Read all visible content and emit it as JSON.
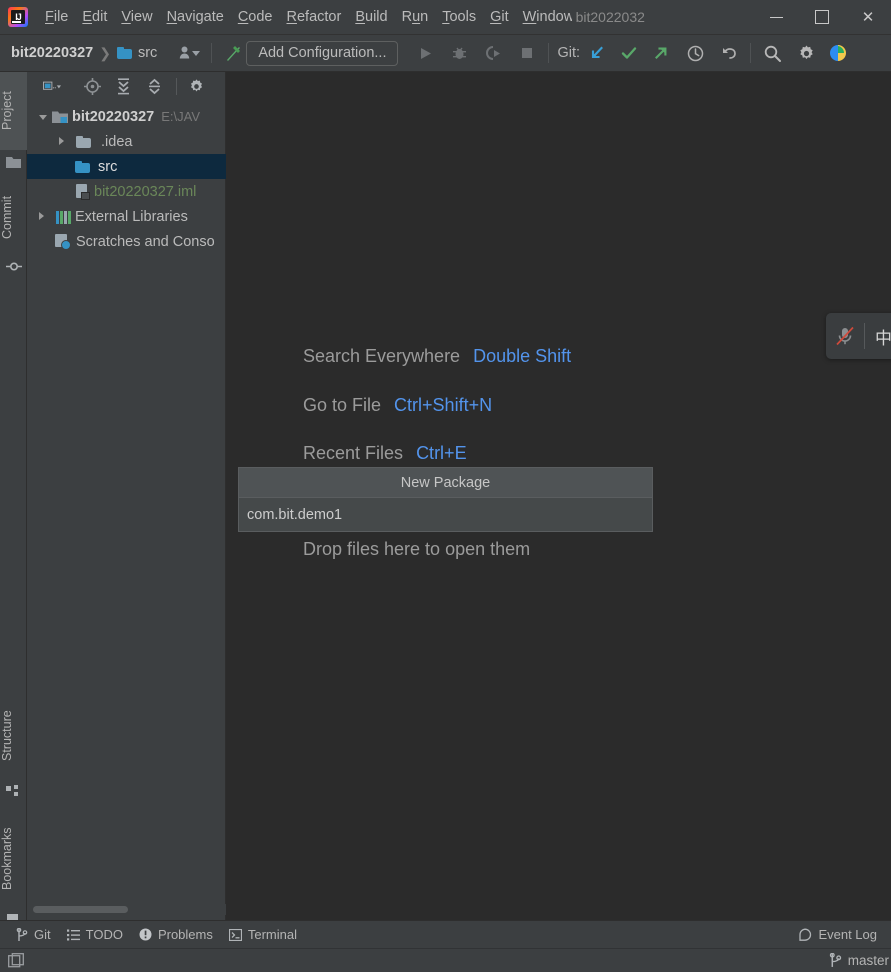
{
  "window": {
    "title": "bit2022032",
    "logo_text": "IJ",
    "minimize_label": "Minimize",
    "maximize_label": "Maximize",
    "close_label": "✕"
  },
  "menubar": {
    "items": [
      {
        "label": "File",
        "mnemonic": "F"
      },
      {
        "label": "Edit",
        "mnemonic": "E"
      },
      {
        "label": "View",
        "mnemonic": "V"
      },
      {
        "label": "Navigate",
        "mnemonic": "N"
      },
      {
        "label": "Code",
        "mnemonic": "C"
      },
      {
        "label": "Refactor",
        "mnemonic": "R"
      },
      {
        "label": "Build",
        "mnemonic": "B"
      },
      {
        "label": "Run",
        "mnemonic": "u"
      },
      {
        "label": "Tools",
        "mnemonic": "T"
      },
      {
        "label": "Git",
        "mnemonic": "G"
      },
      {
        "label": "Window",
        "mnemonic": "W"
      }
    ]
  },
  "navbar": {
    "breadcrumb_root": "bit20220327",
    "breadcrumb_separator": "❯",
    "breadcrumb_leaf": "src",
    "add_configuration_label": "Add Configuration...",
    "git_label": "Git:",
    "icons": {
      "user": "user-dropdown-icon",
      "build": "build-hammer-icon",
      "run": "run-icon",
      "debug": "debug-icon",
      "run_coverage": "run-with-coverage-icon",
      "stop": "stop-icon",
      "git_update": "git-update-project-icon",
      "git_commit": "git-commit-icon",
      "git_push": "git-push-icon",
      "git_history": "git-history-icon",
      "git_rollback": "git-rollback-icon",
      "search": "search-everywhere-icon",
      "settings": "settings-gear-icon",
      "plugin": "plugin-icon"
    }
  },
  "left_toolstrip": {
    "tabs": [
      {
        "label": "Project",
        "active": true,
        "icon": "project-folder-icon"
      },
      {
        "label": "Commit",
        "active": false,
        "icon": "commit-icon"
      },
      {
        "label": "Structure",
        "active": false,
        "icon": "structure-icon"
      },
      {
        "label": "Bookmarks",
        "active": false,
        "icon": "bookmark-icon"
      }
    ]
  },
  "project_panel": {
    "toolbar_icons": [
      "project-view-select-icon",
      "scroll-from-source-icon",
      "expand-all-icon",
      "collapse-all-icon",
      "settings-gear-icon"
    ],
    "tree": [
      {
        "label": "bit20220327",
        "detail": "E:\\JAV",
        "icon": "module-folder-icon",
        "expander": "down",
        "indent": 0,
        "selected": false,
        "bold": true,
        "color": "#cfcfcf"
      },
      {
        "label": ".idea",
        "detail": "",
        "icon": "folder-icon",
        "expander": "right",
        "indent": 1,
        "selected": false,
        "bold": false,
        "color": "#bbbbbb"
      },
      {
        "label": "src",
        "detail": "",
        "icon": "source-folder-icon",
        "expander": "none",
        "indent": 2,
        "selected": true,
        "bold": false,
        "color": "#dddddd"
      },
      {
        "label": "bit20220327.iml",
        "detail": "",
        "icon": "iml-file-icon",
        "expander": "none",
        "indent": 2,
        "selected": false,
        "bold": false,
        "color": "#6a8759"
      },
      {
        "label": "External Libraries",
        "detail": "",
        "icon": "library-icon",
        "expander": "right",
        "indent": 0,
        "selected": false,
        "bold": false,
        "color": "#bbbbbb"
      },
      {
        "label": "Scratches and Conso",
        "detail": "",
        "icon": "scratches-icon",
        "expander": "none",
        "indent": 1,
        "selected": false,
        "bold": false,
        "color": "#bbbbbb"
      }
    ]
  },
  "editor": {
    "hints": [
      {
        "text": "Search Everywhere",
        "shortcut": "Double Shift"
      },
      {
        "text": "Go to File",
        "shortcut": "Ctrl+Shift+N"
      },
      {
        "text": "Recent Files",
        "shortcut": "Ctrl+E"
      },
      {
        "text": "Drop files here to open them",
        "shortcut": ""
      }
    ]
  },
  "popup": {
    "title": "New Package",
    "value": "com.bit.demo1",
    "placeholder": ""
  },
  "ime_widget": {
    "mic_icon": "microphone-muted-icon",
    "language": "中"
  },
  "toolwindow_bar": {
    "left": [
      {
        "label": "Git",
        "icon": "git-branch-icon"
      },
      {
        "label": "TODO",
        "icon": "todo-list-icon"
      },
      {
        "label": "Problems",
        "icon": "problems-icon"
      },
      {
        "label": "Terminal",
        "icon": "terminal-icon"
      }
    ],
    "right": [
      {
        "label": "Event Log",
        "icon": "event-log-icon"
      }
    ]
  },
  "statusbar": {
    "left_icon": "toggle-tool-windows-icon",
    "branch": "master",
    "branch_icon": "git-branch-icon"
  },
  "colors": {
    "panel_bg": "#3c3f41",
    "editor_bg": "#2b2b2b",
    "selection": "#0d293e",
    "accent_blue": "#5394ec",
    "folder_blue": "#3592c4",
    "green_text": "#6a8759",
    "text": "#bbbbbb",
    "popup_bg": "#45494a",
    "popup_head": "#4f5355"
  }
}
